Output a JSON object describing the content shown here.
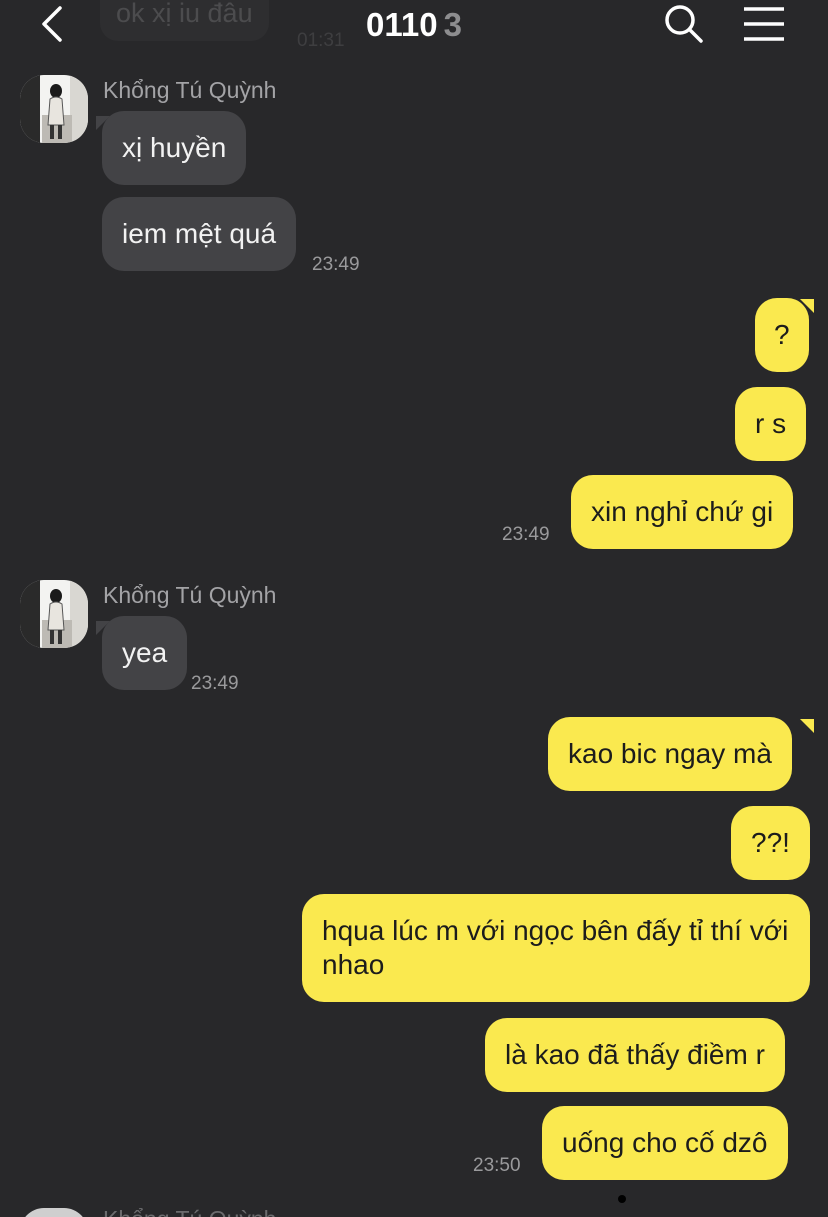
{
  "header": {
    "ghost_message": "ok xị iu đâu",
    "ghost_time": "01:31",
    "title": "0110",
    "member_count": "3",
    "icons": {
      "back": "back-chevron-icon",
      "search": "search-icon",
      "menu": "menu-icon"
    }
  },
  "messages": [
    {
      "type": "in",
      "sender": "Khổng Tú Quỳnh",
      "text": "xị huyền"
    },
    {
      "type": "in",
      "text": "iem mệt quá",
      "time": "23:49"
    },
    {
      "type": "out",
      "text": "?"
    },
    {
      "type": "out",
      "text": "r s"
    },
    {
      "type": "out",
      "text": "xin nghỉ chứ gi",
      "time": "23:49"
    },
    {
      "type": "in",
      "sender": "Khổng Tú Quỳnh",
      "text": "yea",
      "time": "23:49"
    },
    {
      "type": "out",
      "text": "kao bic ngay mà"
    },
    {
      "type": "out",
      "text": "??!"
    },
    {
      "type": "out",
      "text": "hqua lúc m với ngọc bên đấy tỉ thí với nhao"
    },
    {
      "type": "out",
      "text": "là kao đã thấy điềm r"
    },
    {
      "type": "out",
      "text": "uống cho cố dzô",
      "time": "23:50"
    }
  ],
  "peek": {
    "sender": "Khổng Tú Quỳnh"
  },
  "colors": {
    "background": "#28282a",
    "incoming_bubble": "#434346",
    "outgoing_bubble": "#fae94f",
    "timestamp": "#9a9a9c"
  }
}
